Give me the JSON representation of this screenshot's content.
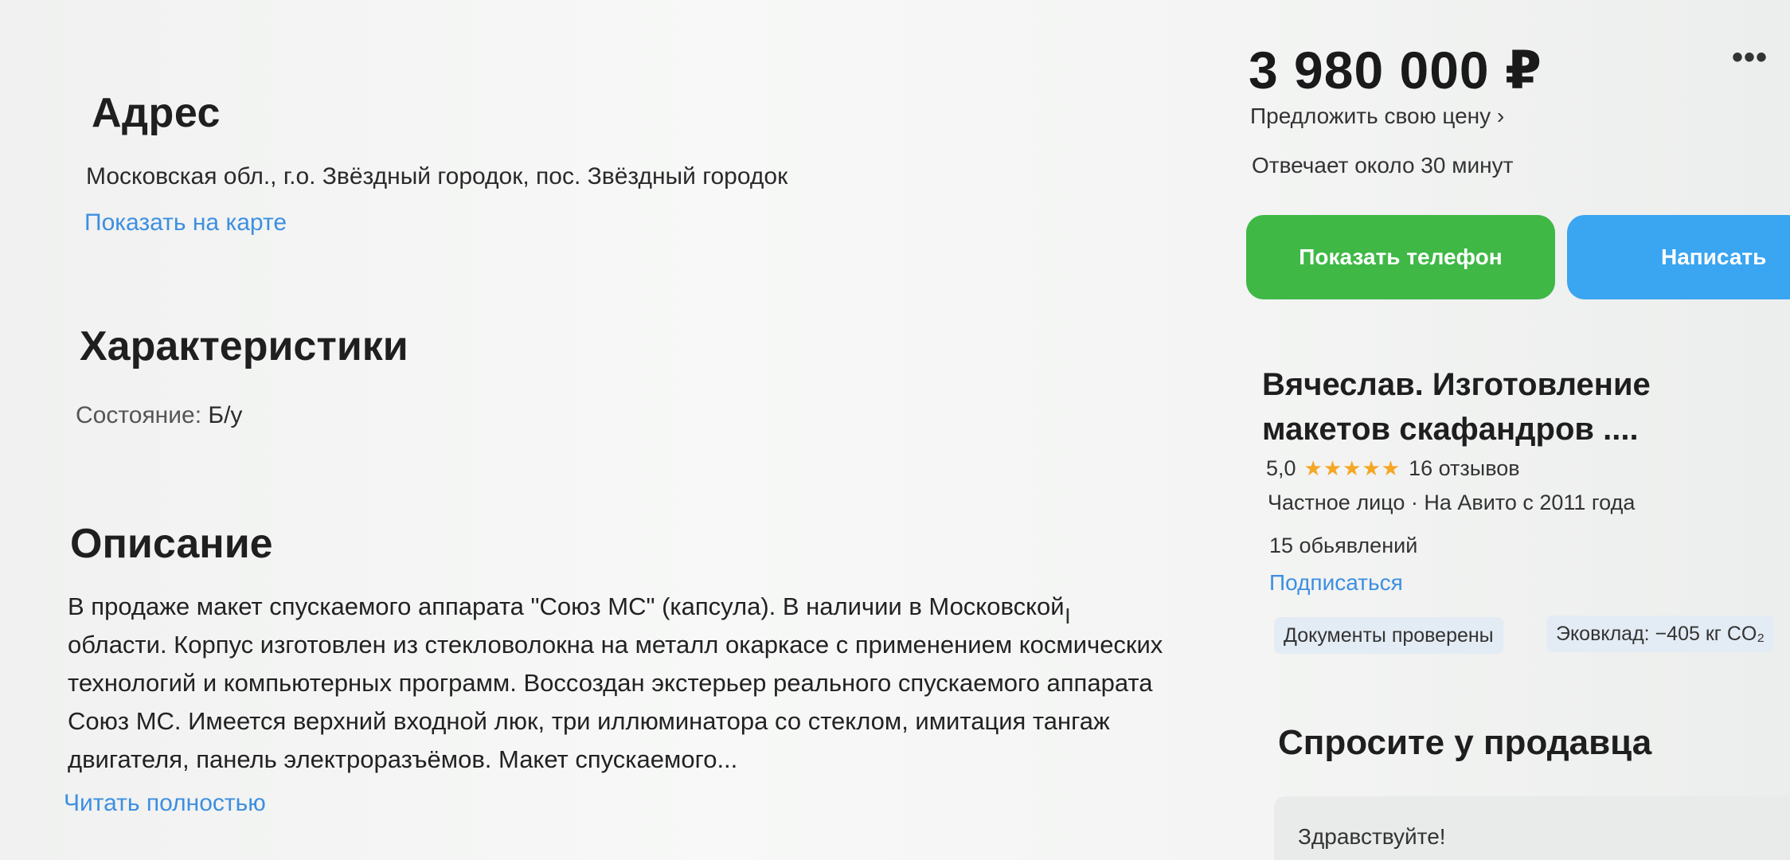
{
  "address": {
    "heading": "Адрес",
    "text": "Московская обл., г.о. Звёздный городок, пос. Звёздный городок",
    "map_link": "Показать на карте"
  },
  "specs": {
    "heading": "Характеристики",
    "items": [
      {
        "label": "Состояние:",
        "value": "Б/у"
      }
    ]
  },
  "description": {
    "heading": "Описание",
    "text": "В продаже макет спускаемого аппарата \"Союз МС\" (капсула). В наличии в Московской области. Корпус изготовлен из стекловолокна на металл окаркасе с применением космических технологий и компьютерных программ. Воссоздан экстерьер реального спускаемого аппарата Союз МС. Имеется верхний входной люк, три иллюминатора со стеклом, имитация тангаж двигателя, панель электроразъёмов. Макет спускаемого...",
    "read_more": "Читать полностью"
  },
  "sidebar": {
    "price": "3 980 000 ₽",
    "more_icon": "more-dots-icon",
    "offer_link": "Предложить свою цену ›",
    "response_time": "Отвечает около 30 минут",
    "show_phone": "Показать телефон",
    "write": "Написать",
    "seller": {
      "name": "Вячеслав. Изготовление макетов скафандров ....",
      "rating": "5,0",
      "stars": "★★★★★",
      "star_count": 5,
      "reviews": "16 отзывов",
      "type": "Частное лицо · На Авито с 2011 года",
      "listings": "15 обьявлений",
      "subscribe": "Подписаться"
    },
    "badges": {
      "docs": "Документы проверены",
      "eco": "Эковклад: −405 кг CO₂"
    },
    "ask": {
      "heading": "Спросите у продавца",
      "greeting": "Здравствуйте!"
    }
  },
  "colors": {
    "link": "#3d8fe0",
    "phone_button": "#3fb846",
    "write_button": "#3aa5f0",
    "star": "#f5a623"
  }
}
